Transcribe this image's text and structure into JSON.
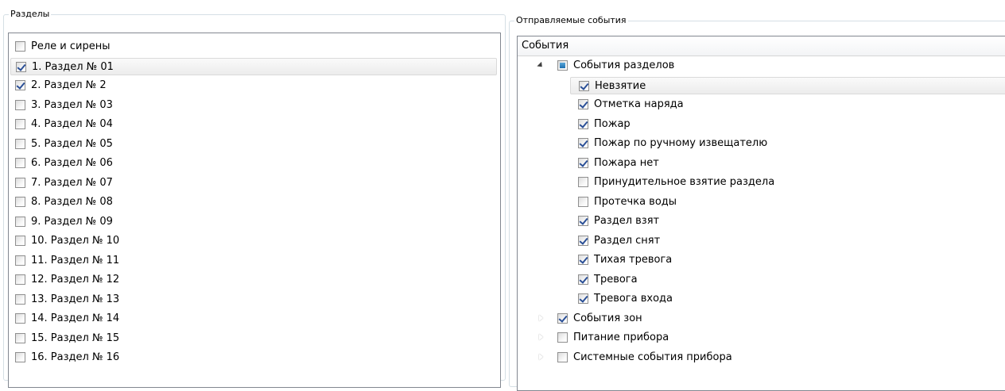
{
  "left_panel": {
    "title": "Разделы",
    "items": [
      {
        "label": "Реле и сирены",
        "checked": false
      },
      {
        "label": "1. Раздел № 01",
        "checked": true,
        "selected": true
      },
      {
        "label": "2. Раздел № 2",
        "checked": true
      },
      {
        "label": "3. Раздел № 03",
        "checked": false
      },
      {
        "label": "4. Раздел № 04",
        "checked": false
      },
      {
        "label": "5. Раздел № 05",
        "checked": false
      },
      {
        "label": "6. Раздел № 06",
        "checked": false
      },
      {
        "label": "7. Раздел № 07",
        "checked": false
      },
      {
        "label": "8. Раздел № 08",
        "checked": false
      },
      {
        "label": "9. Раздел № 09",
        "checked": false
      },
      {
        "label": "10. Раздел № 10",
        "checked": false
      },
      {
        "label": "11. Раздел № 11",
        "checked": false
      },
      {
        "label": "12. Раздел № 12",
        "checked": false
      },
      {
        "label": "13. Раздел № 13",
        "checked": false
      },
      {
        "label": "14. Раздел № 14",
        "checked": false
      },
      {
        "label": "15. Раздел № 15",
        "checked": false
      },
      {
        "label": "16. Раздел № 16",
        "checked": false
      }
    ]
  },
  "right_panel": {
    "title": "Отправляемые события",
    "column_header": "События",
    "groups": [
      {
        "label": "События разделов",
        "state": "partial",
        "expanded": true,
        "children": [
          {
            "label": "Невзятие",
            "checked": true,
            "selected": true
          },
          {
            "label": "Отметка наряда",
            "checked": true
          },
          {
            "label": "Пожар",
            "checked": true
          },
          {
            "label": "Пожар по ручному извещателю",
            "checked": true
          },
          {
            "label": "Пожара нет",
            "checked": true
          },
          {
            "label": "Принудительное взятие раздела",
            "checked": false
          },
          {
            "label": "Протечка воды",
            "checked": false
          },
          {
            "label": "Раздел взят",
            "checked": true
          },
          {
            "label": "Раздел снят",
            "checked": true
          },
          {
            "label": "Тихая тревога",
            "checked": true
          },
          {
            "label": "Тревога",
            "checked": true
          },
          {
            "label": "Тревога входа",
            "checked": true
          }
        ]
      },
      {
        "label": "События зон",
        "state": "checked",
        "expanded": false,
        "children": []
      },
      {
        "label": "Питание прибора",
        "state": "unchecked",
        "expanded": false,
        "children": []
      },
      {
        "label": "Системные события прибора",
        "state": "unchecked",
        "expanded": false,
        "children": []
      }
    ]
  }
}
